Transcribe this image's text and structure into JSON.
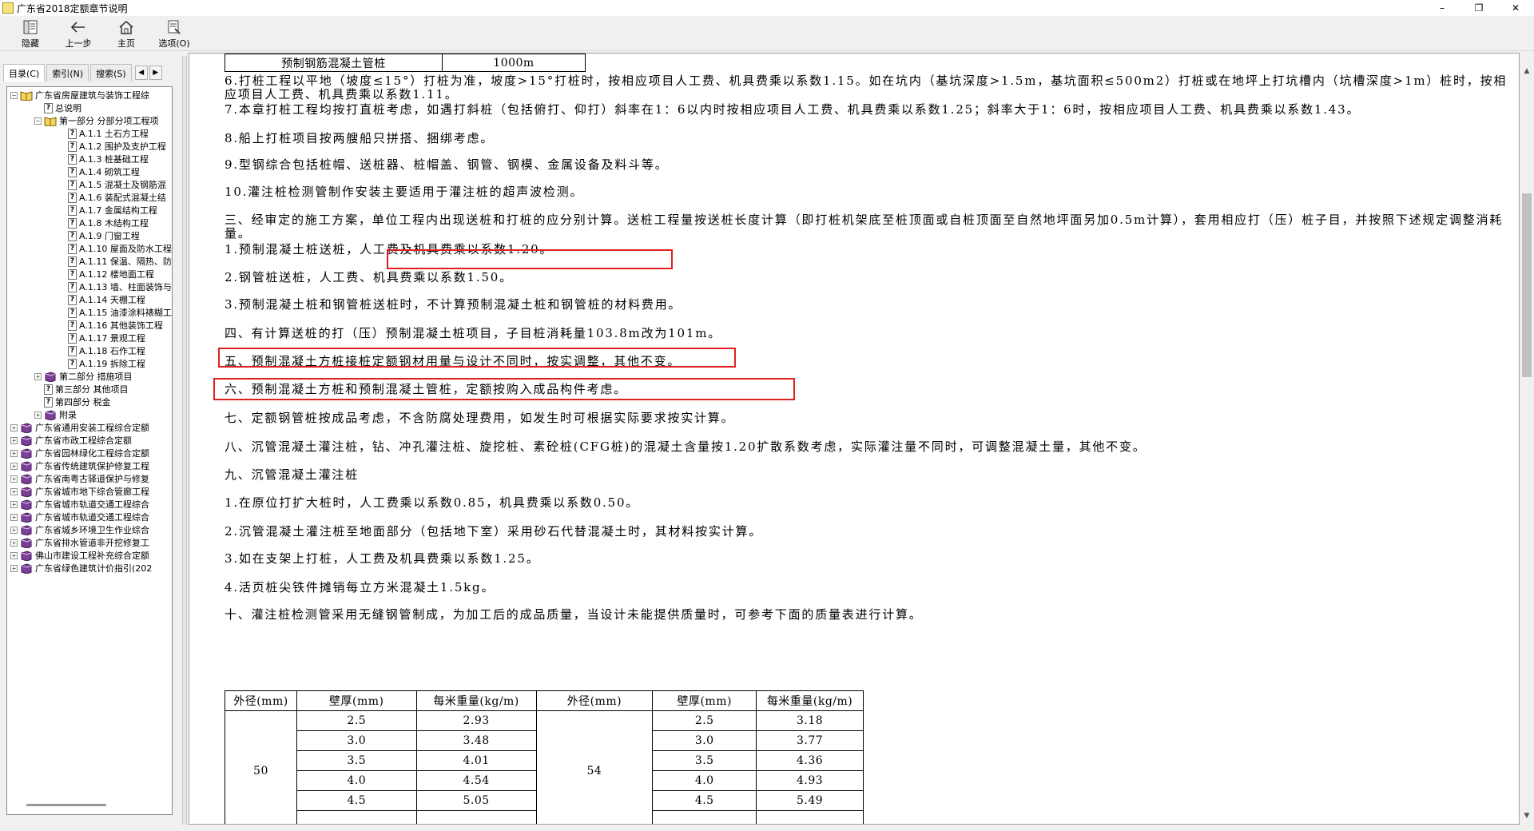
{
  "window": {
    "title": "广东省2018定额章节说明",
    "controls": [
      "–",
      "❐",
      "✕"
    ]
  },
  "toolbar": {
    "hide": "隐藏",
    "back": "上一步",
    "home": "主页",
    "options": "选项(O)"
  },
  "tabs": {
    "contents": "目录(C)",
    "index": "索引(N)",
    "search": "搜索(S)"
  },
  "tree": [
    {
      "label": "广东省房屋建筑与装饰工程综",
      "expander": "⊟",
      "icon": "open-book"
    },
    {
      "label": "总说明",
      "icon": "help"
    },
    {
      "label": "第一部分 分部分项工程项",
      "expander": "⊟",
      "icon": "open-book"
    },
    {
      "label": "A.1.1 土石方工程",
      "icon": "help"
    },
    {
      "label": "A.1.2 围护及支护工程",
      "icon": "help"
    },
    {
      "label": "A.1.3 桩基础工程",
      "icon": "help"
    },
    {
      "label": "A.1.4 砌筑工程",
      "icon": "help"
    },
    {
      "label": "A.1.5 混凝土及钢筋混",
      "icon": "help"
    },
    {
      "label": "A.1.6 装配式混凝土结",
      "icon": "help"
    },
    {
      "label": "A.1.7 金属结构工程",
      "icon": "help"
    },
    {
      "label": "A.1.8 木结构工程",
      "icon": "help"
    },
    {
      "label": "A.1.9 门窗工程",
      "icon": "help"
    },
    {
      "label": "A.1.10 屋面及防水工程",
      "icon": "help"
    },
    {
      "label": "A.1.11 保温、隔热、防",
      "icon": "help"
    },
    {
      "label": "A.1.12 楼地面工程",
      "icon": "help"
    },
    {
      "label": "A.1.13 墙、柱面装饰与",
      "icon": "help"
    },
    {
      "label": "A.1.14 天棚工程",
      "icon": "help"
    },
    {
      "label": "A.1.15 油漆涂料裱糊工",
      "icon": "help"
    },
    {
      "label": "A.1.16 其他装饰工程",
      "icon": "help"
    },
    {
      "label": "A.1.17 景观工程",
      "icon": "help"
    },
    {
      "label": "A.1.18 石作工程",
      "icon": "help"
    },
    {
      "label": "A.1.19 拆除工程",
      "icon": "help"
    },
    {
      "label": "第二部分 措施项目",
      "expander": "⊞",
      "icon": "book"
    },
    {
      "label": "第三部分 其他项目",
      "icon": "help"
    },
    {
      "label": "第四部分 税金",
      "icon": "help"
    },
    {
      "label": "附录",
      "expander": "⊞",
      "icon": "book"
    },
    {
      "label": "广东省通用安装工程综合定额",
      "expander": "⊞",
      "icon": "book"
    },
    {
      "label": "广东省市政工程综合定额",
      "expander": "⊞",
      "icon": "book"
    },
    {
      "label": "广东省园林绿化工程综合定额",
      "expander": "⊞",
      "icon": "book"
    },
    {
      "label": "广东省传统建筑保护修复工程",
      "expander": "⊞",
      "icon": "book"
    },
    {
      "label": "广东省南粤古驿道保护与修复",
      "expander": "⊞",
      "icon": "book"
    },
    {
      "label": "广东省城市地下综合管廊工程",
      "expander": "⊞",
      "icon": "book"
    },
    {
      "label": "广东省城市轨道交通工程综合",
      "expander": "⊞",
      "icon": "book"
    },
    {
      "label": "广东省城市轨道交通工程综合",
      "expander": "⊞",
      "icon": "book"
    },
    {
      "label": "广东省城乡环境卫生作业综合",
      "expander": "⊞",
      "icon": "book"
    },
    {
      "label": "广东省排水管道非开挖修复工",
      "expander": "⊞",
      "icon": "book"
    },
    {
      "label": "佛山市建设工程补充综合定额",
      "expander": "⊞",
      "icon": "book"
    },
    {
      "label": "广东省绿色建筑计价指引(202",
      "expander": "⊞",
      "icon": "book"
    }
  ],
  "top_table": {
    "item": "预制钢筋混凝土管桩",
    "value": "1000m"
  },
  "paragraphs": [
    "6.打桩工程以平地（坡度≤15°）打桩为准，坡度>15°打桩时，按相应项目人工费、机具费乘以系数1.15。如在坑内（基坑深度>1.5m，基坑面积≤500m2）打桩或在地坪上打坑槽内（坑槽深度>1m）桩时，按相应项目人工费、机具费乘以系数1.11。",
    "7.本章打桩工程均按打直桩考虑，如遇打斜桩（包括俯打、仰打）斜率在1：6以内时按相应项目人工费、机具费乘以系数1.25；斜率大于1：6时，按相应项目人工费、机具费乘以系数1.43。",
    "8.船上打桩项目按两艘船只拼搭、捆绑考虑。",
    "9.型钢综合包括桩帽、送桩器、桩帽盖、钢管、钢模、金属设备及料斗等。",
    "10.灌注桩检测管制作安装主要适用于灌注桩的超声波检测。",
    "三、经审定的施工方案，单位工程内出现送桩和打桩的应分别计算。送桩工程量按送桩长度计算（即打桩机架底至桩顶面或自桩顶面至自然地坪面另加0.5m计算），套用相应打（压）桩子目，并按照下述规定调整消耗量。",
    "1.预制混凝土桩送桩，人工费及机具费乘以系数1.20。",
    "2.钢管桩送桩，人工费、机具费乘以系数1.50。",
    "3.预制混凝土桩和钢管桩送桩时，不计算预制混凝土桩和钢管桩的材料费用。",
    "四、有计算送桩的打（压）预制混凝土桩项目，子目桩消耗量103.8m改为101m。",
    "五、预制混凝土方桩接桩定额钢材用量与设计不同时，按实调整，其他不变。",
    "六、预制混凝土方桩和预制混凝土管桩，定额按购入成品构件考虑。",
    "七、定额钢管桩按成品考虑，不含防腐处理费用，如发生时可根据实际要求按实计算。",
    "八、沉管混凝土灌注桩，钻、冲孔灌注桩、旋挖桩、素砼桩(CFG桩)的混凝土含量按1.20扩散系数考虑，实际灌注量不同时，可调整混凝土量，其他不变。",
    "九、沉管混凝土灌注桩",
    "1.在原位打扩大桩时，人工费乘以系数0.85，机具费乘以系数0.50。",
    "2.沉管混凝土灌注桩至地面部分（包括地下室）采用砂石代替混凝土时，其材料按实计算。",
    "3.如在支架上打桩，人工费及机具费乘以系数1.25。",
    "4.活页桩尖铁件摊销每立方米混凝土1.5kg。",
    "十、灌注桩检测管采用无缝钢管制成，为加工后的成品质量，当设计未能提供质量时，可参考下面的质量表进行计算。"
  ],
  "weight_table": {
    "headers": [
      "外径(mm)",
      "壁厚(mm)",
      "每米重量(kg/m)",
      "外径(mm)",
      "壁厚(mm)",
      "每米重量(kg/m)"
    ],
    "left_diameter": "50",
    "right_diameter": "54",
    "rows": [
      [
        "2.5",
        "2.93",
        "2.5",
        "3.18"
      ],
      [
        "3.0",
        "3.48",
        "3.0",
        "3.77"
      ],
      [
        "3.5",
        "4.01",
        "3.5",
        "4.36"
      ],
      [
        "4.0",
        "4.54",
        "4.0",
        "4.93"
      ],
      [
        "4.5",
        "5.05",
        "4.5",
        "5.49"
      ]
    ]
  },
  "colors": {
    "highlight": "#e02020",
    "window_bg": "#f0f0f0"
  }
}
